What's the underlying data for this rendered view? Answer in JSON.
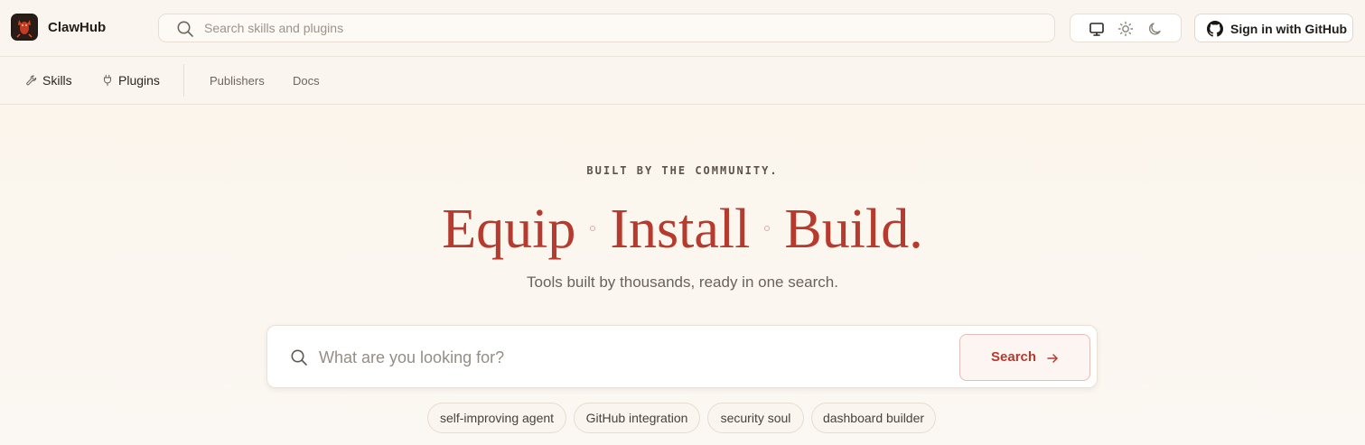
{
  "header": {
    "brand": "ClawHub",
    "search_placeholder": "Search skills and plugins",
    "theme_options": [
      "monitor-icon",
      "sun-icon",
      "moon-icon"
    ],
    "signin_label": "Sign in with GitHub"
  },
  "nav": {
    "items": [
      {
        "label": "Skills",
        "icon": "wrench-icon"
      },
      {
        "label": "Plugins",
        "icon": "plug-icon"
      }
    ],
    "links": [
      "Publishers",
      "Docs"
    ]
  },
  "hero": {
    "eyebrow": "BUILT BY THE COMMUNITY.",
    "headline_words": [
      "Equip",
      "Install",
      "Build."
    ],
    "subline": "Tools built by thousands, ready in one search.",
    "search_placeholder": "What are you looking for?",
    "search_button": "Search",
    "chips": [
      "self-improving agent",
      "GitHub integration",
      "security soul",
      "dashboard builder"
    ]
  },
  "colors": {
    "accent": "#b63a2d",
    "background": "#fbf6ef"
  }
}
